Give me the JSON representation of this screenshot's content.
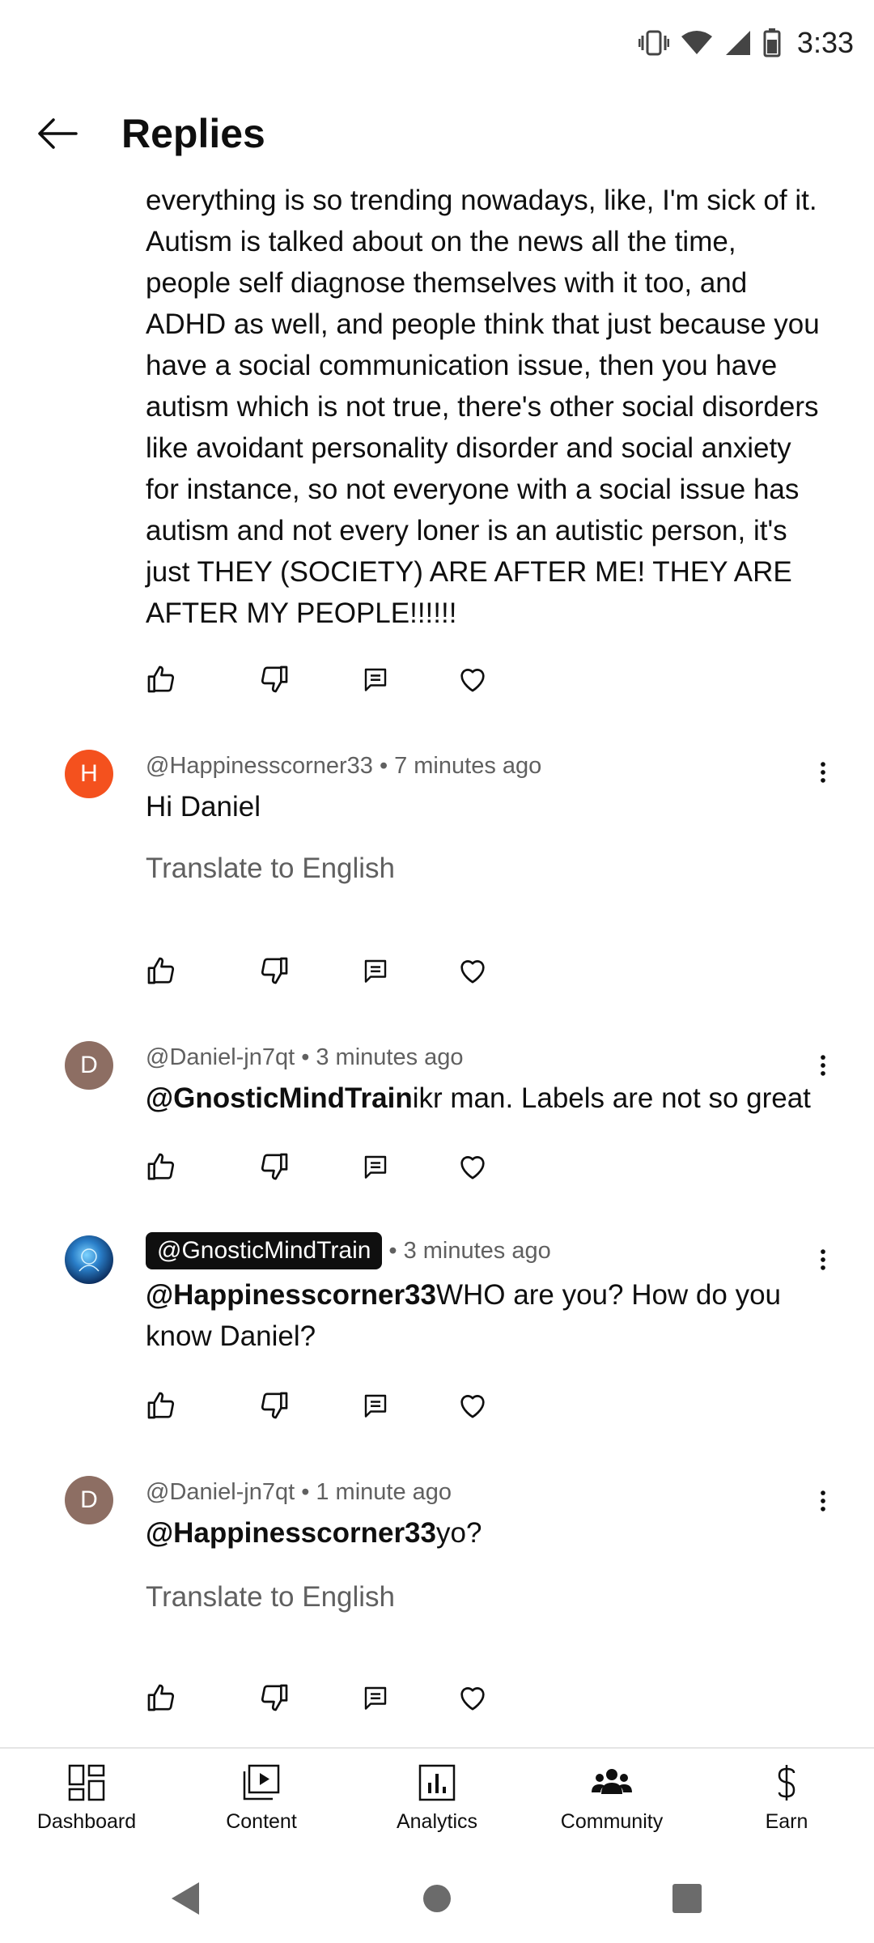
{
  "status_bar": {
    "time": "3:33"
  },
  "header": {
    "title": "Replies"
  },
  "top_comment": {
    "text": "everything is so trending nowadays, like, I'm sick of it. Autism is talked about on the news all the time, people self diagnose themselves with it too, and ADHD as well, and people think that just because you have a social communication issue, then you have autism which is not true, there's other social disorders like avoidant personality disorder and social anxiety for instance, so not everyone with a social issue has autism and not every loner is an autistic person, it's just THEY (SOCIETY) ARE AFTER ME! THEY ARE AFTER MY PEOPLE!!!!!!"
  },
  "replies": [
    {
      "avatar_letter": "H",
      "avatar_color": "#f4511e",
      "author": "@Happinesscorner33",
      "time": "7 minutes ago",
      "text": "Hi Daniel",
      "translate": "Translate to English"
    },
    {
      "avatar_letter": "D",
      "avatar_color": "#8d6e63",
      "author": "@Daniel-jn7qt",
      "time": "3 minutes ago",
      "mention": "@GnosticMindTrain",
      "text": "ikr man. Labels are not so great"
    },
    {
      "author": "@GnosticMindTrain",
      "time": "3 minutes ago",
      "mention": "@Happinesscorner33",
      "text": "WHO are you? How do you know Daniel?"
    },
    {
      "avatar_letter": "D",
      "avatar_color": "#8d6e63",
      "author": "@Daniel-jn7qt",
      "time": "1 minute ago",
      "mention": "@Happinesscorner33",
      "text": "yo?",
      "translate": "Translate to English"
    }
  ],
  "separator": "•",
  "bottom_nav": {
    "dashboard": "Dashboard",
    "content": "Content",
    "analytics": "Analytics",
    "community": "Community",
    "earn": "Earn"
  },
  "icons": {
    "back": "arrow-left-icon",
    "like": "thumb-up-icon",
    "dislike": "thumb-down-icon",
    "reply": "comment-icon",
    "heart": "heart-icon",
    "more": "more-vert-icon"
  }
}
